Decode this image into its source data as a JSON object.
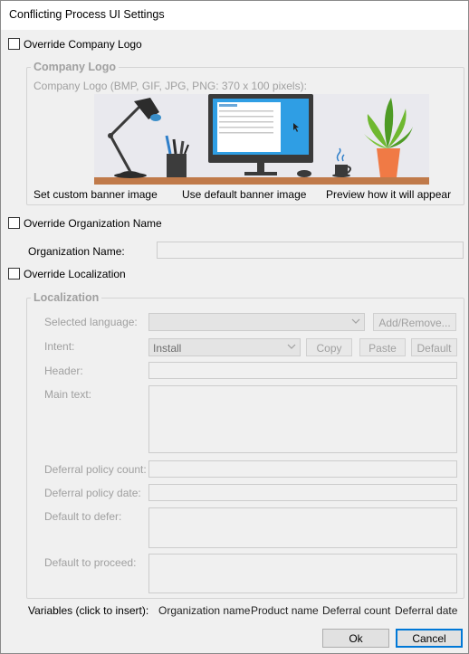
{
  "window": {
    "title": "Conflicting Process UI Settings"
  },
  "logo": {
    "override_label": "Override Company Logo",
    "group_title": "Company Logo",
    "hint": "Company Logo (BMP, GIF, JPG, PNG: 370 x 100 pixels):",
    "set_custom": "Set custom banner image",
    "use_default": "Use default banner image",
    "preview": "Preview how it will appear"
  },
  "organization": {
    "override_label": "Override Organization Name",
    "name_label": "Organization Name:",
    "name_value": ""
  },
  "localization": {
    "override_label": "Override Localization",
    "group_title": "Localization",
    "selected_language_label": "Selected language:",
    "selected_language_value": "",
    "add_remove": "Add/Remove...",
    "intent_label": "Intent:",
    "intent_value": "Install",
    "copy": "Copy",
    "paste": "Paste",
    "default": "Default",
    "header_label": "Header:",
    "main_text_label": "Main text:",
    "deferral_count_label": "Deferral policy count:",
    "deferral_date_label": "Deferral policy date:",
    "default_defer_label": "Default to defer:",
    "default_proceed_label": "Default to proceed:"
  },
  "variables": {
    "label": "Variables (click to insert):",
    "items": [
      "Organization name",
      "Product name",
      "Deferral count",
      "Deferral date"
    ]
  },
  "footer": {
    "ok": "Ok",
    "cancel": "Cancel"
  },
  "colors": {
    "accent": "#0078d7",
    "banner_bg": "#e9e9ee",
    "monitor_screen": "#2f9ee4",
    "desk": "#c07a4a",
    "pot": "#f07a45"
  }
}
